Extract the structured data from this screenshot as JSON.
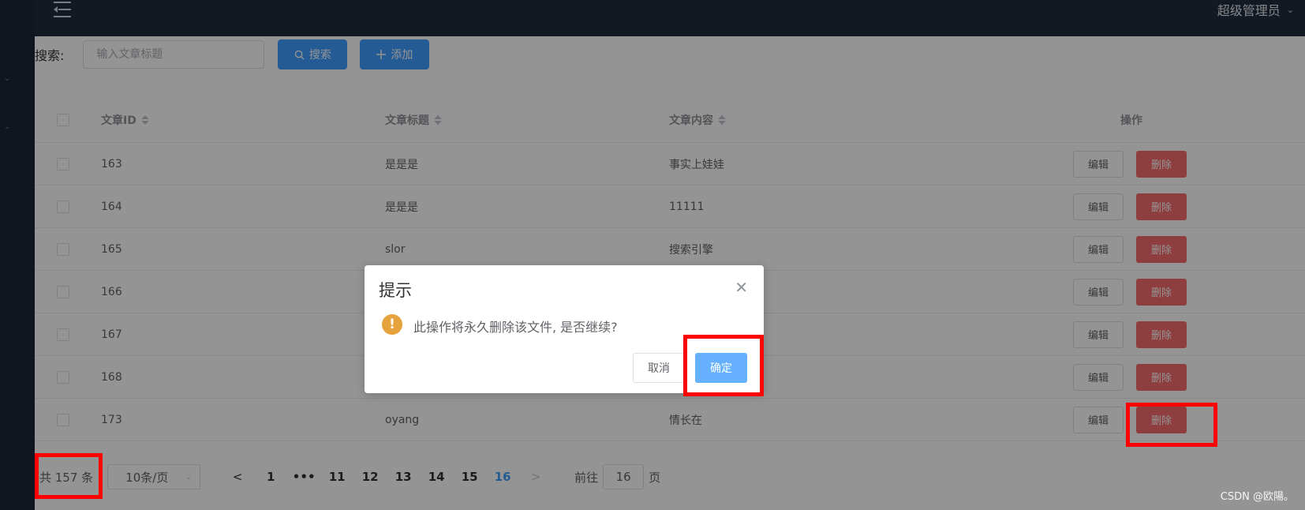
{
  "header": {
    "user_name": "超级管理员"
  },
  "toolbar": {
    "search_label": "搜索:",
    "search_placeholder": "输入文章标题",
    "search_button": "搜索",
    "add_button": "添加"
  },
  "table": {
    "columns": [
      "文章ID",
      "文章标题",
      "文章内容",
      "操作"
    ],
    "rows": [
      {
        "id": "163",
        "title": "是是是",
        "content": "事实上娃娃"
      },
      {
        "id": "164",
        "title": "是是是",
        "content": "11111"
      },
      {
        "id": "165",
        "title": "slor",
        "content": "搜索引擎"
      },
      {
        "id": "166",
        "title": "",
        "content": ""
      },
      {
        "id": "167",
        "title": "",
        "content": ""
      },
      {
        "id": "168",
        "title": "",
        "content": ""
      },
      {
        "id": "173",
        "title": "oyang",
        "content": "情长在"
      }
    ],
    "edit_label": "编辑",
    "delete_label": "删除"
  },
  "pagination": {
    "total": "共 157 条",
    "page_size": "10条/页",
    "pages": [
      "1",
      "•••",
      "11",
      "12",
      "13",
      "14",
      "15",
      "16"
    ],
    "current_page": "16",
    "goto_prefix": "前往",
    "goto_value": "16",
    "goto_suffix": "页"
  },
  "dialog": {
    "title": "提示",
    "message": "此操作将永久删除该文件, 是否继续?",
    "cancel_label": "取消",
    "confirm_label": "确定"
  },
  "watermark": "CSDN @欧陽。",
  "colors": {
    "primary": "#409eff",
    "danger": "#f56c6c",
    "warning": "#e6a23c",
    "highlight": "#ff0000",
    "header_bg": "#212c3d"
  }
}
